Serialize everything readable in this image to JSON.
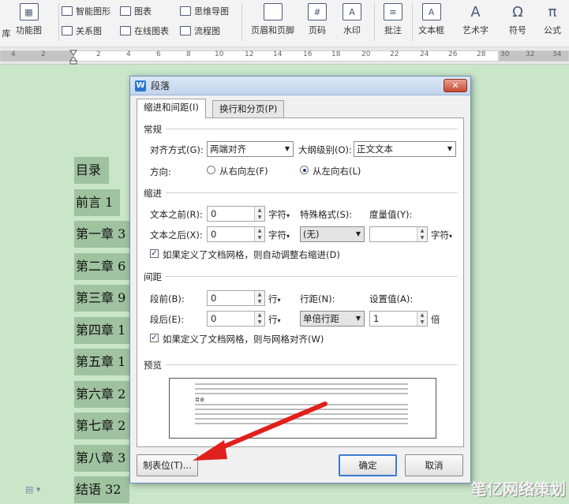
{
  "ribbon": {
    "partial_left": "库",
    "func_chart": "功能图",
    "smart_art": "智能图形",
    "relation_chart": "关系图",
    "chart": "图表",
    "online_chart": "在线图表",
    "mind_map": "思维导图",
    "flow_chart": "流程图",
    "header_footer": "页眉和页脚",
    "page_number": "页码",
    "watermark": "水印",
    "comment": "批注",
    "text_box": "文本框",
    "art_text": "艺术字",
    "symbol": "符号",
    "formula": "公式"
  },
  "ruler": {
    "ticks": [
      "4",
      "2",
      "2",
      "4",
      "6",
      "8",
      "10",
      "12",
      "14",
      "16",
      "18",
      "20",
      "22",
      "24",
      "26",
      "28",
      "30",
      "32",
      "34"
    ]
  },
  "document": {
    "lines": [
      "目录",
      "前言 1",
      "第一章 3",
      "第二章 6",
      "第三章 9",
      "第四章 1",
      "第五章 1",
      "第六章 2",
      "第七章 2",
      "第八章 3",
      "结语 32"
    ]
  },
  "dialog": {
    "title": "段落",
    "close": "✕",
    "tabs": [
      "缩进和间距(I)",
      "换行和分页(P)"
    ],
    "general": {
      "section": "常规",
      "align_label": "对齐方式(G):",
      "align_value": "两端对齐",
      "outline_label": "大纲级别(O):",
      "outline_value": "正文文本",
      "direction_label": "方向:",
      "rtl": "从右向左(F)",
      "ltr": "从左向右(L)"
    },
    "indent": {
      "section": "缩进",
      "before_label": "文本之前(R):",
      "before_value": "0",
      "before_unit": "字符",
      "after_label": "文本之后(X):",
      "after_value": "0",
      "after_unit": "字符",
      "special_label": "特殊格式(S):",
      "special_value": "(无)",
      "measure_label": "度量值(Y):",
      "measure_value": "",
      "measure_unit": "字符",
      "auto_adjust": "如果定义了文档网格，则自动调整右缩进(D)"
    },
    "spacing": {
      "section": "间距",
      "before_label": "段前(B):",
      "before_value": "0",
      "before_unit": "行",
      "after_label": "段后(E):",
      "after_value": "0",
      "after_unit": "行",
      "line_label": "行距(N):",
      "line_value": "单倍行距",
      "set_label": "设置值(A):",
      "set_value": "1",
      "set_unit": "倍",
      "snap_grid": "如果定义了文档网格，则与网格对齐(W)"
    },
    "preview": {
      "section": "预览",
      "text": "目录"
    },
    "tabs_button": "制表位(T)...",
    "ok": "确定",
    "cancel": "取消"
  },
  "watermark_text": "笔亿网络策划"
}
